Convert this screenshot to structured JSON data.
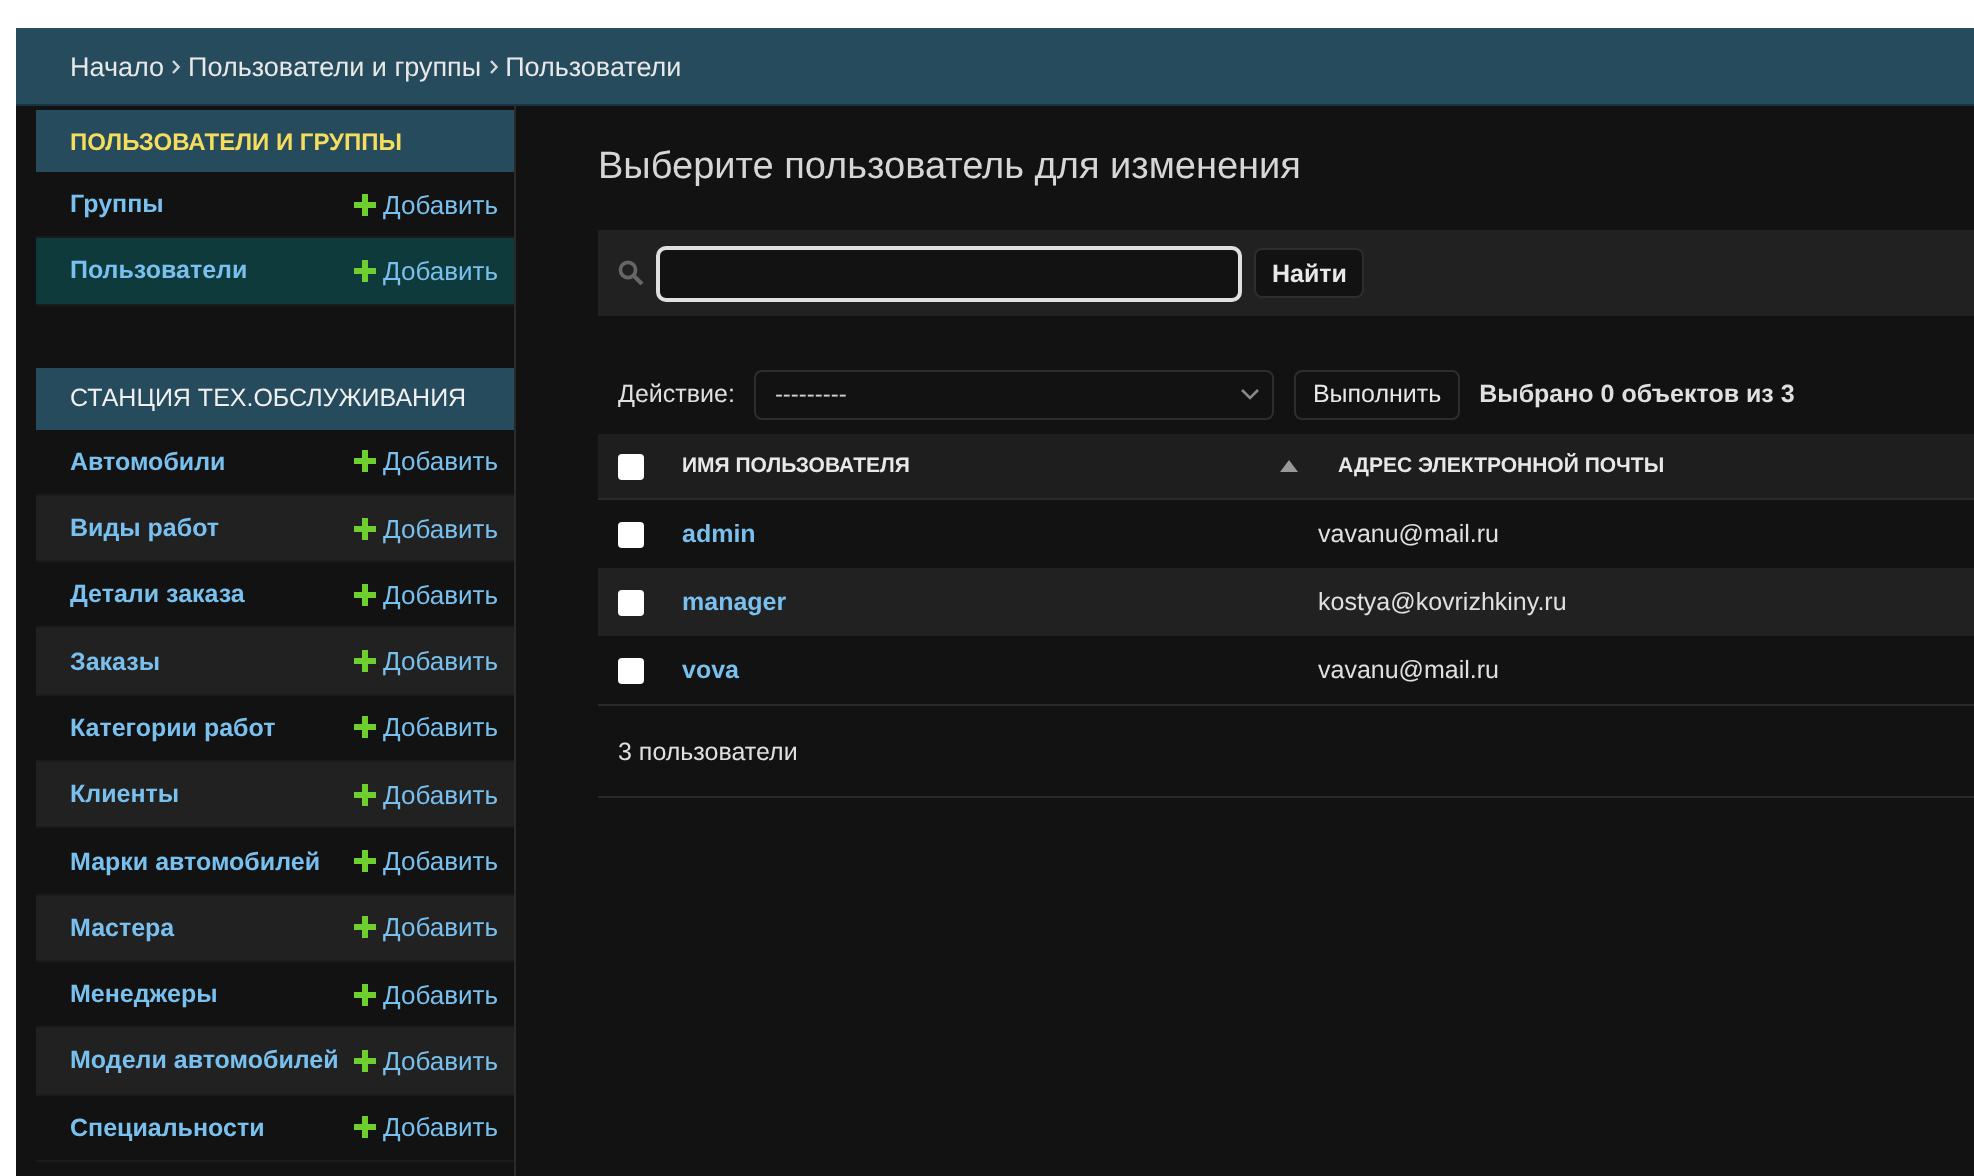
{
  "breadcrumbs": [
    "Начало",
    "Пользователи и группы",
    "Пользователи"
  ],
  "sidebar": [
    {
      "title": "ПОЛЬЗОВАТЕЛИ И ГРУППЫ",
      "items": [
        {
          "label": "Группы",
          "add": "Добавить",
          "selected": false
        },
        {
          "label": "Пользователи",
          "add": "Добавить",
          "selected": true
        }
      ]
    },
    {
      "title": "СТАНЦИЯ ТЕХ.ОБСЛУЖИВАНИЯ",
      "items": [
        {
          "label": "Автомобили",
          "add": "Добавить",
          "selected": false
        },
        {
          "label": "Виды работ",
          "add": "Добавить",
          "selected": false
        },
        {
          "label": "Детали заказа",
          "add": "Добавить",
          "selected": false
        },
        {
          "label": "Заказы",
          "add": "Добавить",
          "selected": false
        },
        {
          "label": "Категории работ",
          "add": "Добавить",
          "selected": false
        },
        {
          "label": "Клиенты",
          "add": "Добавить",
          "selected": false
        },
        {
          "label": "Марки автомобилей",
          "add": "Добавить",
          "selected": false
        },
        {
          "label": "Мастера",
          "add": "Добавить",
          "selected": false
        },
        {
          "label": "Менеджеры",
          "add": "Добавить",
          "selected": false
        },
        {
          "label": "Модели автомобилей",
          "add": "Добавить",
          "selected": false
        },
        {
          "label": "Специальности",
          "add": "Добавить",
          "selected": false
        }
      ]
    }
  ],
  "title": "Выберите пользователь для изменения",
  "search": {
    "button": "Найти"
  },
  "actions": {
    "label": "Действие:",
    "value": "---------",
    "button": "Выполнить",
    "counter": "Выбрано 0 объектов из 3"
  },
  "table": {
    "select_all": {
      "checked": false
    },
    "columns": [
      {
        "label": "ИМЯ ПОЛЬЗОВАТЕЛЯ",
        "sorted": true
      },
      {
        "label": "АДРЕС ЭЛЕКТРОННОЙ ПОЧТЫ",
        "sorted": false
      }
    ],
    "rows": [
      {
        "checked": false,
        "username": "admin",
        "email": "vavanu@mail.ru"
      },
      {
        "checked": false,
        "username": "manager",
        "email": "kostya@kovrizhkiny.ru"
      },
      {
        "checked": false,
        "username": "vova",
        "email": "vavanu@mail.ru"
      }
    ]
  },
  "footer": "3 пользователи"
}
